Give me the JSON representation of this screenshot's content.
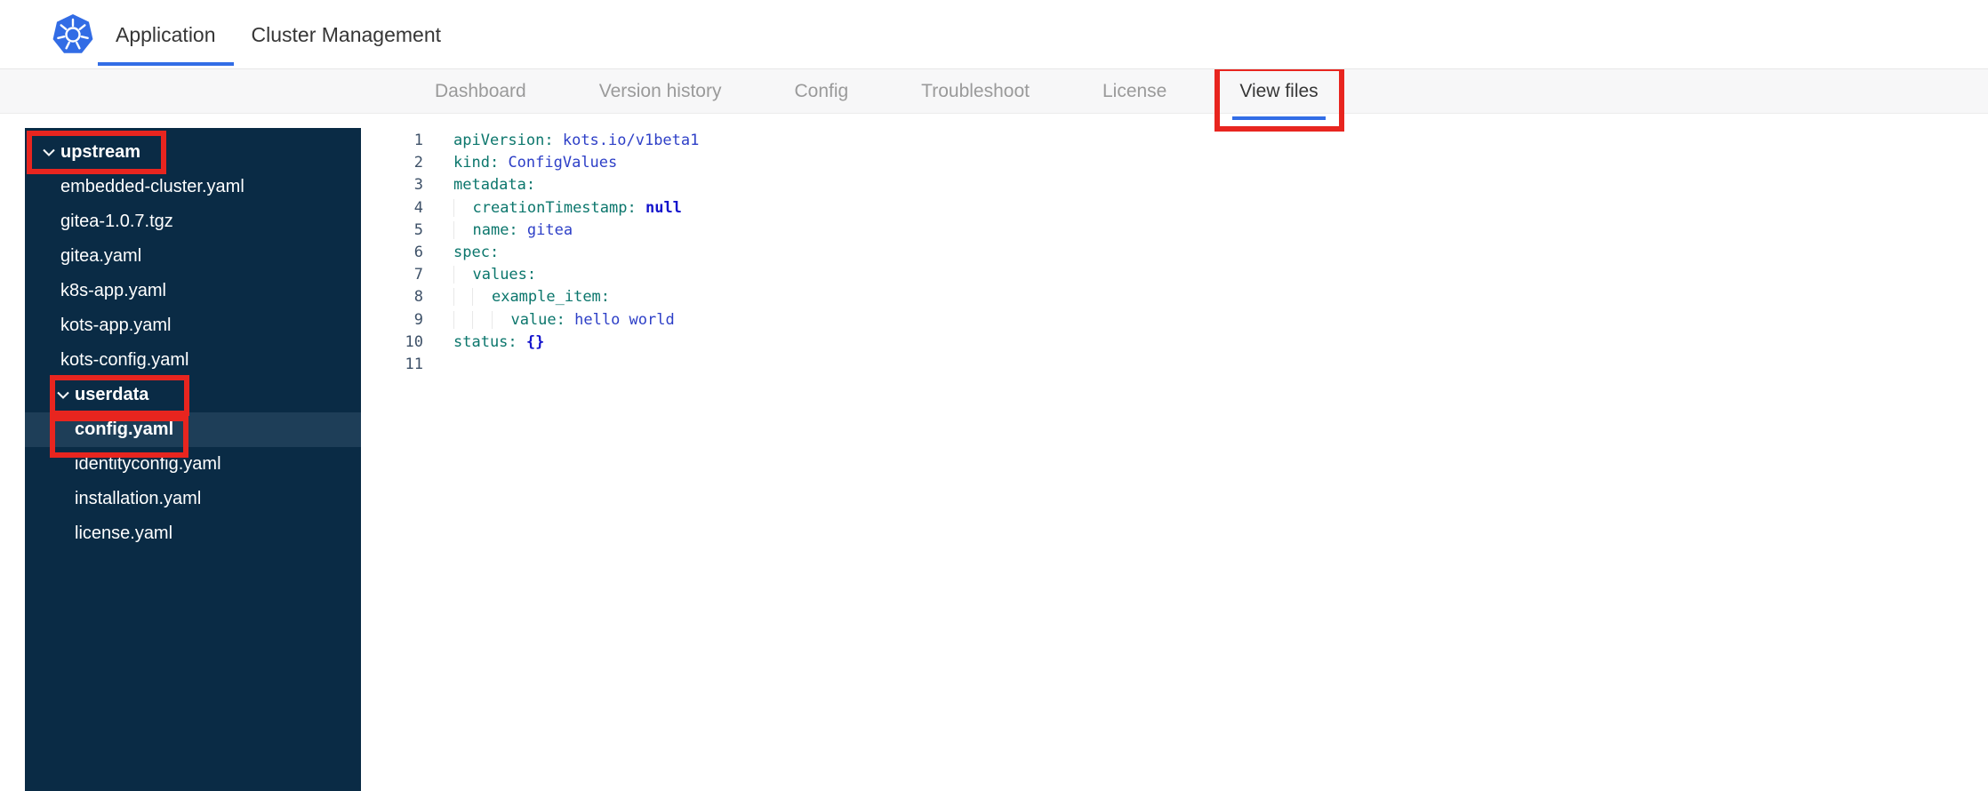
{
  "colors": {
    "accent-blue": "#326de6",
    "annotation-red": "#e8251f",
    "sidebar-bg": "#0a2b45",
    "sidebar-selected": "#1e3e58",
    "code-key": "#0b766c",
    "code-value": "#2d3fc7",
    "code-const": "#1414cc",
    "gutter": "#3e5168"
  },
  "header": {
    "logo": "kubernetes-logo",
    "tabs": [
      {
        "label": "Application",
        "active": true
      },
      {
        "label": "Cluster Management",
        "active": false
      }
    ]
  },
  "subnav": {
    "tabs": [
      {
        "label": "Dashboard",
        "active": false,
        "annotated": false
      },
      {
        "label": "Version history",
        "active": false,
        "annotated": false
      },
      {
        "label": "Config",
        "active": false,
        "annotated": false
      },
      {
        "label": "Troubleshoot",
        "active": false,
        "annotated": false
      },
      {
        "label": "License",
        "active": false,
        "annotated": false
      },
      {
        "label": "View files",
        "active": true,
        "annotated": true
      }
    ]
  },
  "file_tree": {
    "items": [
      {
        "type": "folder",
        "label": "upstream",
        "level": 0,
        "expanded": true,
        "selected": false,
        "annotated": true
      },
      {
        "type": "file",
        "label": "embedded-cluster.yaml",
        "level": 1,
        "selected": false,
        "annotated": false
      },
      {
        "type": "file",
        "label": "gitea-1.0.7.tgz",
        "level": 1,
        "selected": false,
        "annotated": false
      },
      {
        "type": "file",
        "label": "gitea.yaml",
        "level": 1,
        "selected": false,
        "annotated": false
      },
      {
        "type": "file",
        "label": "k8s-app.yaml",
        "level": 1,
        "selected": false,
        "annotated": false
      },
      {
        "type": "file",
        "label": "kots-app.yaml",
        "level": 1,
        "selected": false,
        "annotated": false
      },
      {
        "type": "file",
        "label": "kots-config.yaml",
        "level": 1,
        "selected": false,
        "annotated": false
      },
      {
        "type": "folder",
        "label": "userdata",
        "level": 1,
        "expanded": true,
        "selected": false,
        "annotated": true
      },
      {
        "type": "file",
        "label": "config.yaml",
        "level": 2,
        "selected": true,
        "annotated": true
      },
      {
        "type": "file",
        "label": "identityconfig.yaml",
        "level": 2,
        "selected": false,
        "annotated": false
      },
      {
        "type": "file",
        "label": "installation.yaml",
        "level": 2,
        "selected": false,
        "annotated": false
      },
      {
        "type": "file",
        "label": "license.yaml",
        "level": 2,
        "selected": false,
        "annotated": false
      }
    ]
  },
  "editor": {
    "language": "yaml",
    "line_count": 11,
    "lines": [
      {
        "indent": 0,
        "tokens": [
          [
            "key",
            "apiVersion:"
          ],
          [
            "plain",
            " "
          ],
          [
            "value",
            "kots.io/v1beta1"
          ]
        ]
      },
      {
        "indent": 0,
        "tokens": [
          [
            "key",
            "kind:"
          ],
          [
            "plain",
            " "
          ],
          [
            "value",
            "ConfigValues"
          ]
        ]
      },
      {
        "indent": 0,
        "tokens": [
          [
            "key",
            "metadata:"
          ]
        ]
      },
      {
        "indent": 2,
        "tokens": [
          [
            "key",
            "creationTimestamp:"
          ],
          [
            "plain",
            " "
          ],
          [
            "const",
            "null"
          ]
        ]
      },
      {
        "indent": 2,
        "tokens": [
          [
            "key",
            "name:"
          ],
          [
            "plain",
            " "
          ],
          [
            "value",
            "gitea"
          ]
        ]
      },
      {
        "indent": 0,
        "tokens": [
          [
            "key",
            "spec:"
          ]
        ]
      },
      {
        "indent": 2,
        "tokens": [
          [
            "key",
            "values:"
          ]
        ]
      },
      {
        "indent": 4,
        "tokens": [
          [
            "key",
            "example_item:"
          ]
        ]
      },
      {
        "indent": 6,
        "tokens": [
          [
            "key",
            "value:"
          ],
          [
            "plain",
            " "
          ],
          [
            "value",
            "hello world"
          ]
        ]
      },
      {
        "indent": 0,
        "tokens": [
          [
            "key",
            "status:"
          ],
          [
            "plain",
            " "
          ],
          [
            "const",
            "{}"
          ]
        ]
      },
      {
        "indent": 0,
        "tokens": []
      }
    ]
  }
}
